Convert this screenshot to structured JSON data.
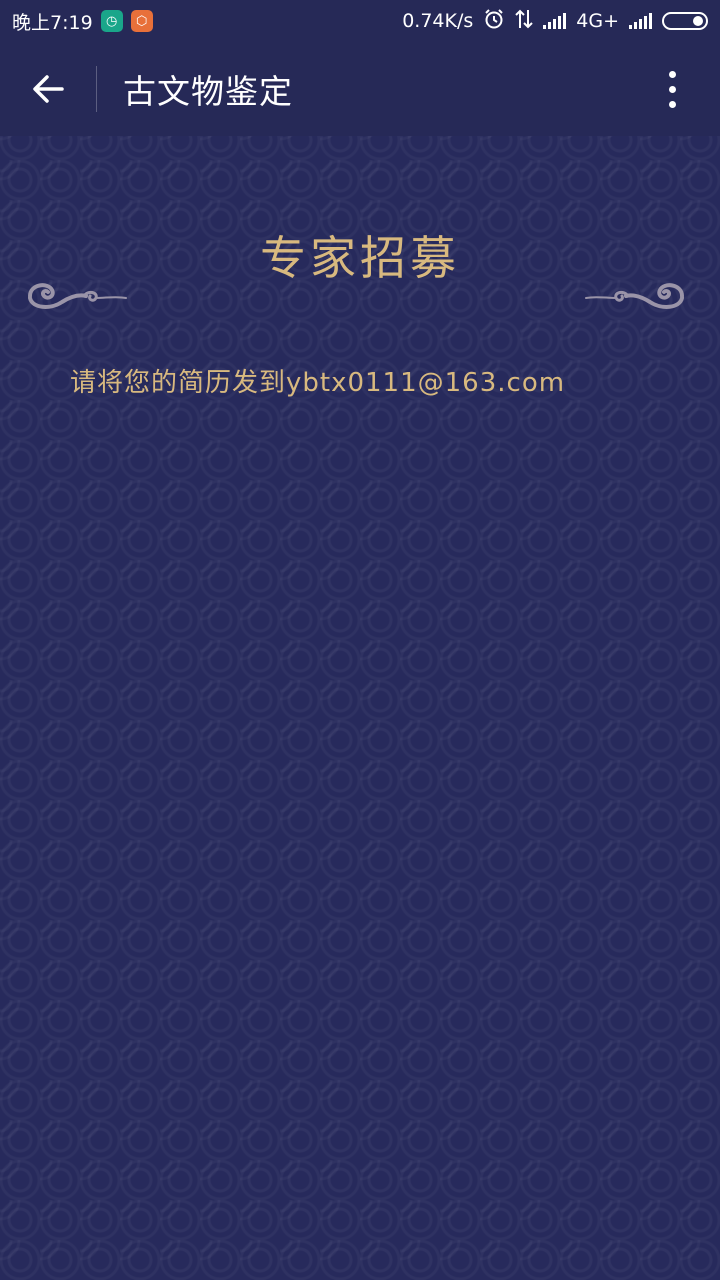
{
  "status_bar": {
    "time": "晚上7:19",
    "net_speed": "0.74K/s",
    "network": "4G+"
  },
  "app_bar": {
    "title": "古文物鉴定"
  },
  "content": {
    "heading": "专家招募",
    "message": "请将您的简历发到ybtx0111@163.com"
  },
  "colors": {
    "background": "#272a5c",
    "gold_text": "#d8b97f",
    "cloud": "#9a94a8"
  },
  "icons": {
    "back": "arrow-left-icon",
    "more": "more-vertical-icon",
    "alarm": "alarm-icon",
    "data_arrows": "data-transfer-icon",
    "signal": "signal-icon",
    "battery": "battery-icon",
    "cloud": "auspicious-cloud-ornament"
  }
}
